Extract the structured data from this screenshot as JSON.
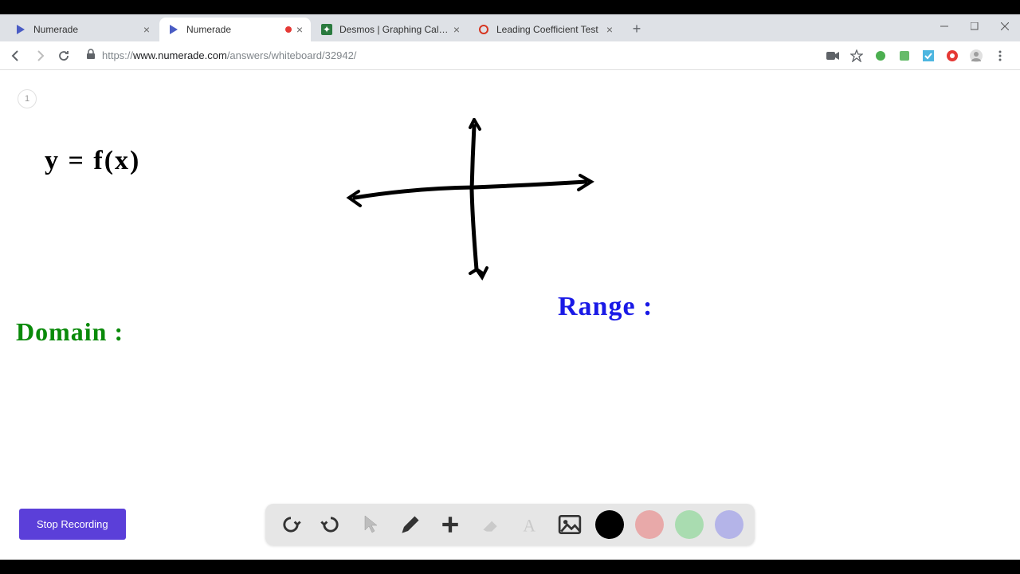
{
  "tabs": [
    {
      "title": "Numerade"
    },
    {
      "title": "Numerade"
    },
    {
      "title": "Desmos | Graphing Calculator"
    },
    {
      "title": "Leading Coefficient Test"
    }
  ],
  "url": {
    "scheme": "https://",
    "host": "www.numerade.com",
    "path": "/answers/whiteboard/32942/"
  },
  "page_badge": "1",
  "whiteboard": {
    "equation": "y = f(x)",
    "domain_label": "Domain :",
    "range_label": "Range :"
  },
  "controls": {
    "stop_recording": "Stop Recording"
  },
  "colors": {
    "black": "#000000",
    "pink": "#e8a9a9",
    "green": "#a9dcb0",
    "purple": "#b4b4e8"
  }
}
